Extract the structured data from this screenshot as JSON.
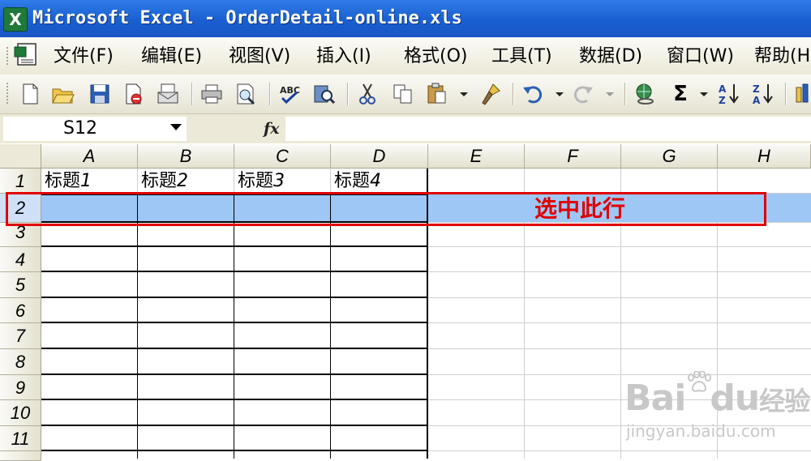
{
  "window": {
    "title": "Microsoft Excel - OrderDetail-online.xls"
  },
  "menu": [
    {
      "label": "文件(F)"
    },
    {
      "label": "编辑(E)"
    },
    {
      "label": "视图(V)"
    },
    {
      "label": "插入(I)"
    },
    {
      "label": "格式(O)"
    },
    {
      "label": "工具(T)"
    },
    {
      "label": "数据(D)"
    },
    {
      "label": "窗口(W)"
    },
    {
      "label": "帮助(H)"
    }
  ],
  "toolbar": {
    "icons": [
      "new-icon",
      "open-icon",
      "save-icon",
      "permission-icon",
      "email-icon",
      "print-icon",
      "print-preview-icon",
      "spelling-icon",
      "research-icon",
      "cut-icon",
      "copy-icon",
      "paste-icon",
      "format-painter-icon",
      "undo-icon",
      "redo-icon",
      "hyperlink-icon",
      "autosum-icon",
      "sort-ascending-icon",
      "sort-descending-icon"
    ],
    "autosum_symbol": "Σ"
  },
  "formula_bar": {
    "name_box": "S12",
    "fx_label": "fx",
    "value": ""
  },
  "grid": {
    "columns": [
      "A",
      "B",
      "C",
      "D",
      "E",
      "F",
      "G",
      "H"
    ],
    "rows": [
      "1",
      "2",
      "3",
      "4",
      "5",
      "6",
      "7",
      "8",
      "9",
      "10",
      "11"
    ],
    "headers": [
      {
        "text": "标题",
        "num": "1"
      },
      {
        "text": "标题",
        "num": "2"
      },
      {
        "text": "标题",
        "num": "3"
      },
      {
        "text": "标题",
        "num": "4"
      }
    ],
    "selected_row": "2"
  },
  "annotation": {
    "text": "选中此行",
    "color": "#e00000"
  },
  "watermark": {
    "brand": "Bai",
    "brand2": "du",
    "cn": "经验",
    "url": "jingyan.baidu.com"
  },
  "colors": {
    "titlebar": "#1a5fd1",
    "selection": "#9ec7f5",
    "chrome": "#ece9d8"
  }
}
